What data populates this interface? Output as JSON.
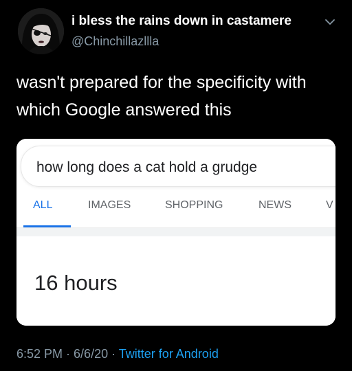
{
  "author": {
    "display_name": "i bless the rains down in castamere",
    "handle": "@Chinchillazllla"
  },
  "icons": {
    "avatar": "avatar",
    "menu": "chevron-down-icon"
  },
  "tweet": {
    "text": "wasn't prepared for the specificity with which Google answered this"
  },
  "google": {
    "query": "how long does a cat hold a grudge",
    "tabs": [
      "ALL",
      "IMAGES",
      "SHOPPING",
      "NEWS",
      "V"
    ],
    "active_tab": "ALL",
    "answer": "16 hours"
  },
  "meta": {
    "time": "6:52 PM",
    "separator1": " · ",
    "date": "6/6/20",
    "separator2": " · ",
    "source": "Twitter for Android"
  },
  "colors": {
    "background": "#000000",
    "secondary_text": "#8899a6",
    "link": "#1da1f2",
    "google_blue": "#1a73e8"
  }
}
